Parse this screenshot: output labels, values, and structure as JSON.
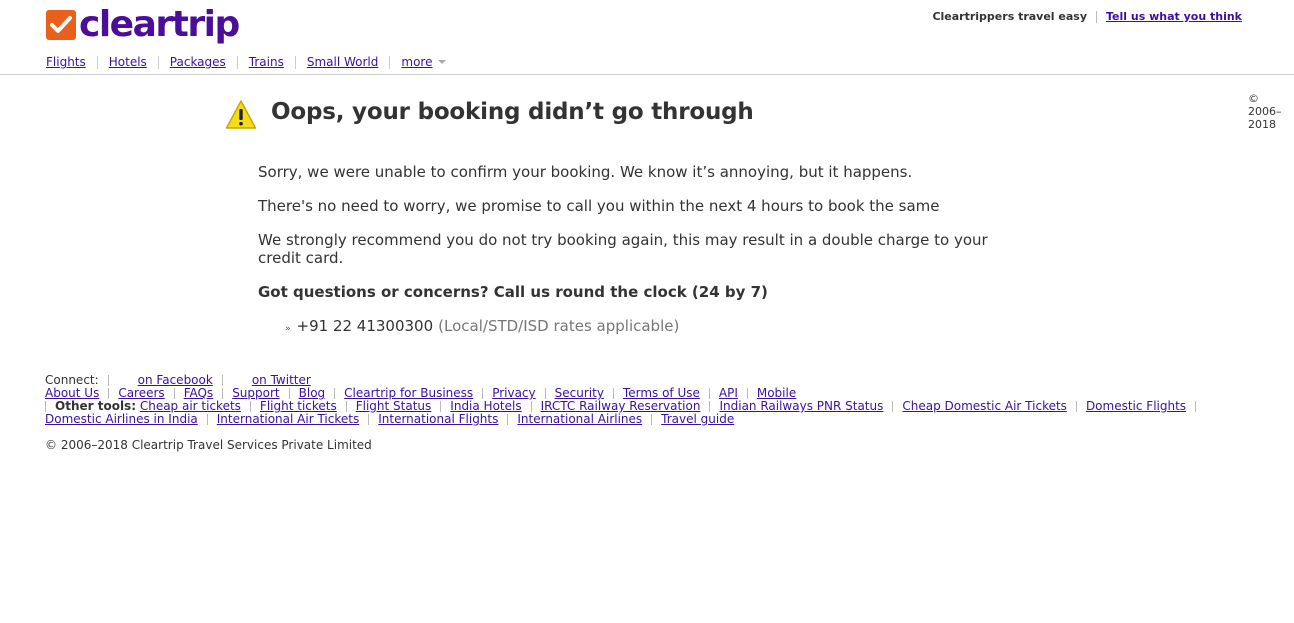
{
  "header": {
    "logo_text": "cleartrip",
    "tagline": "Cleartrippers travel easy",
    "feedback_link": "Tell us what you think",
    "brand_colors": {
      "logo_orange": "#e8601c",
      "logo_purple": "#4a0e98",
      "link": "#3b11a3"
    }
  },
  "nav": {
    "items": [
      "Flights",
      "Hotels",
      "Packages",
      "Trains",
      "Small World"
    ],
    "more_label": "more"
  },
  "side_copyright": "© 2006–2018",
  "main": {
    "title": "Oops, your booking didn’t go through",
    "paragraphs": [
      "Sorry, we were unable to confirm your booking. We know it’s annoying, but it happens.",
      "There's no need to worry, we promise to call you within the next 4 hours to book the same",
      "We strongly recommend you do not try booking again, this may result in a double charge to your credit card."
    ],
    "question": "Got questions or concerns? Call us round the clock (24 by 7)",
    "phone_bullet": "»",
    "phone": "+91 22 41300300",
    "phone_note": "(Local/STD/ISD rates applicable)"
  },
  "footer": {
    "connect_label": "Connect:",
    "facebook": "on Facebook",
    "twitter": "on Twitter",
    "links": [
      "About Us",
      "Careers",
      "FAQs",
      "Support",
      "Blog",
      "Cleartrip for Business",
      "Privacy",
      "Security",
      "Terms of Use",
      "API",
      "Mobile"
    ],
    "other_tools_label": "Other tools:",
    "other_tools": [
      "Cheap air tickets",
      "Flight tickets",
      "Flight Status",
      "India Hotels",
      "IRCTC Railway Reservation",
      "Indian Railways PNR Status",
      "Cheap Domestic Air Tickets",
      "Domestic Flights",
      "Domestic Airlines in India",
      "International Air Tickets",
      "International Flights",
      "International Airlines",
      "Travel guide"
    ],
    "copyright": "© 2006–2018 Cleartrip Travel Services Private Limited"
  }
}
